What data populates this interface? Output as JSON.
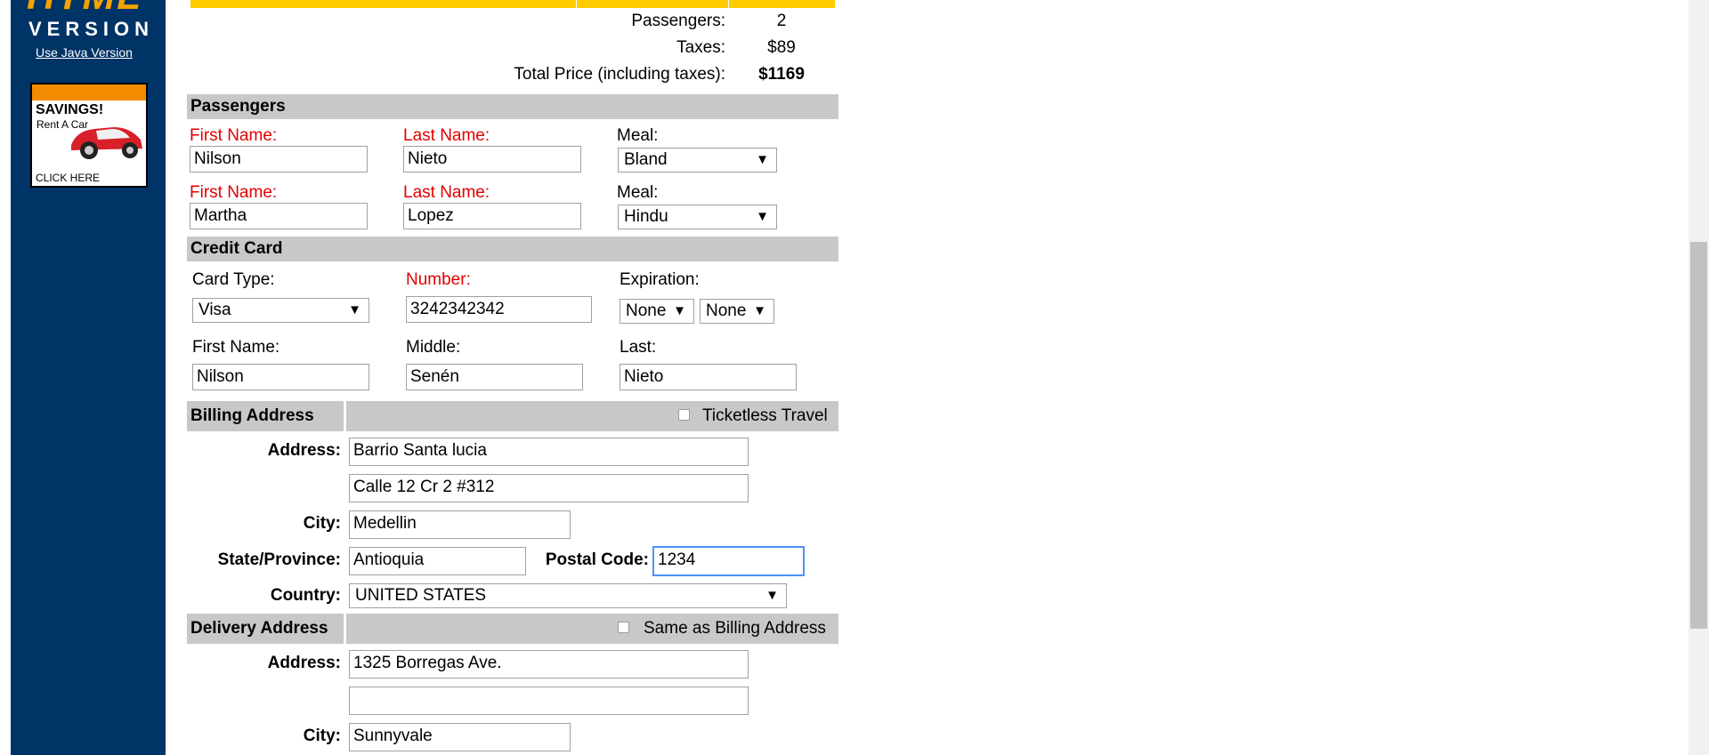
{
  "sidebar": {
    "logo_top": "HTML",
    "logo_bottom": "VERSION",
    "java_link": "Use Java Version",
    "ad": {
      "savings": "SAVINGS!",
      "rent": "Rent A Car",
      "click": "CLICK HERE"
    }
  },
  "summary": {
    "passengers_label": "Passengers:",
    "passengers_value": "2",
    "taxes_label": "Taxes:",
    "taxes_value": "$89",
    "total_label": "Total Price (including taxes):",
    "total_value": "$1169"
  },
  "passengers": {
    "title": "Passengers",
    "first_name_label": "First Name:",
    "last_name_label": "Last Name:",
    "meal_label": "Meal:",
    "rows": [
      {
        "first": "Nilson",
        "last": "Nieto",
        "meal": "Bland"
      },
      {
        "first": "Martha",
        "last": "Lopez",
        "meal": "Hindu"
      }
    ]
  },
  "credit_card": {
    "title": "Credit Card",
    "card_type_label": "Card Type:",
    "card_type": "Visa",
    "number_label": "Number:",
    "number": "3242342342",
    "expiration_label": "Expiration:",
    "exp_month": "None",
    "exp_year": "None",
    "first_name_label": "First Name:",
    "first_name": "Nilson",
    "middle_label": "Middle:",
    "middle": "Senén",
    "last_label": "Last:",
    "last": "Nieto"
  },
  "billing": {
    "title": "Billing Address",
    "ticketless_label": "Ticketless Travel",
    "address_label": "Address:",
    "address1": "Barrio Santa lucia",
    "address2": "Calle 12 Cr 2 #312",
    "city_label": "City:",
    "city": "Medellin",
    "state_label": "State/Province:",
    "state": "Antioquia",
    "postal_label": "Postal Code:",
    "postal": "1234",
    "country_label": "Country:",
    "country": "UNITED STATES"
  },
  "delivery": {
    "title": "Delivery Address",
    "same_label": "Same as Billing Address",
    "address_label": "Address:",
    "address1": "1325 Borregas Ave.",
    "address2": "",
    "city_label": "City:",
    "city": "Sunnyvale"
  },
  "colors": {
    "sidebar": "#003366",
    "accent_yellow": "#ffcc00",
    "required_red": "#e00000",
    "section_gray": "#c8c8c8"
  }
}
